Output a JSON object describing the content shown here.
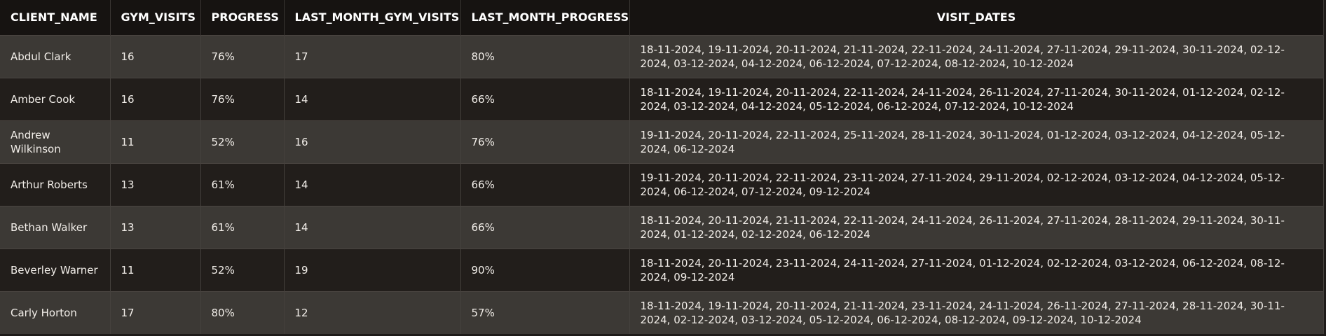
{
  "table": {
    "headers": [
      "CLIENT_NAME",
      "GYM_VISITS",
      "PROGRESS",
      "LAST_MONTH_GYM_VISITS",
      "LAST_MONTH_PROGRESS",
      "VISIT_DATES"
    ],
    "rows": [
      [
        "Abdul Clark",
        "16",
        "76%",
        "17",
        "80%",
        "18-11-2024, 19-11-2024, 20-11-2024, 21-11-2024, 22-11-2024, 24-11-2024, 27-11-2024, 29-11-2024, 30-11-2024, 02-12-2024, 03-12-2024, 04-12-2024, 06-12-2024, 07-12-2024, 08-12-2024, 10-12-2024"
      ],
      [
        "Amber Cook",
        "16",
        "76%",
        "14",
        "66%",
        "18-11-2024, 19-11-2024, 20-11-2024, 22-11-2024, 24-11-2024, 26-11-2024, 27-11-2024, 30-11-2024, 01-12-2024, 02-12-2024, 03-12-2024, 04-12-2024, 05-12-2024, 06-12-2024, 07-12-2024, 10-12-2024"
      ],
      [
        "Andrew Wilkinson",
        "11",
        "52%",
        "16",
        "76%",
        "19-11-2024, 20-11-2024, 22-11-2024, 25-11-2024, 28-11-2024, 30-11-2024, 01-12-2024, 03-12-2024, 04-12-2024, 05-12-2024, 06-12-2024"
      ],
      [
        "Arthur Roberts",
        "13",
        "61%",
        "14",
        "66%",
        "19-11-2024, 20-11-2024, 22-11-2024, 23-11-2024, 27-11-2024, 29-11-2024, 02-12-2024, 03-12-2024, 04-12-2024, 05-12-2024, 06-12-2024, 07-12-2024, 09-12-2024"
      ],
      [
        "Bethan Walker",
        "13",
        "61%",
        "14",
        "66%",
        "18-11-2024, 20-11-2024, 21-11-2024, 22-11-2024, 24-11-2024, 26-11-2024, 27-11-2024, 28-11-2024, 29-11-2024, 30-11-2024, 01-12-2024, 02-12-2024, 06-12-2024"
      ],
      [
        "Beverley Warner",
        "11",
        "52%",
        "19",
        "90%",
        "18-11-2024, 20-11-2024, 23-11-2024, 24-11-2024, 27-11-2024, 01-12-2024, 02-12-2024, 03-12-2024, 06-12-2024, 08-12-2024, 09-12-2024"
      ],
      [
        "Carly Horton",
        "17",
        "80%",
        "12",
        "57%",
        "18-11-2024, 19-11-2024, 20-11-2024, 21-11-2024, 23-11-2024, 24-11-2024, 26-11-2024, 27-11-2024, 28-11-2024, 30-11-2024, 02-12-2024, 03-12-2024, 05-12-2024, 06-12-2024, 08-12-2024, 09-12-2024, 10-12-2024"
      ]
    ]
  }
}
